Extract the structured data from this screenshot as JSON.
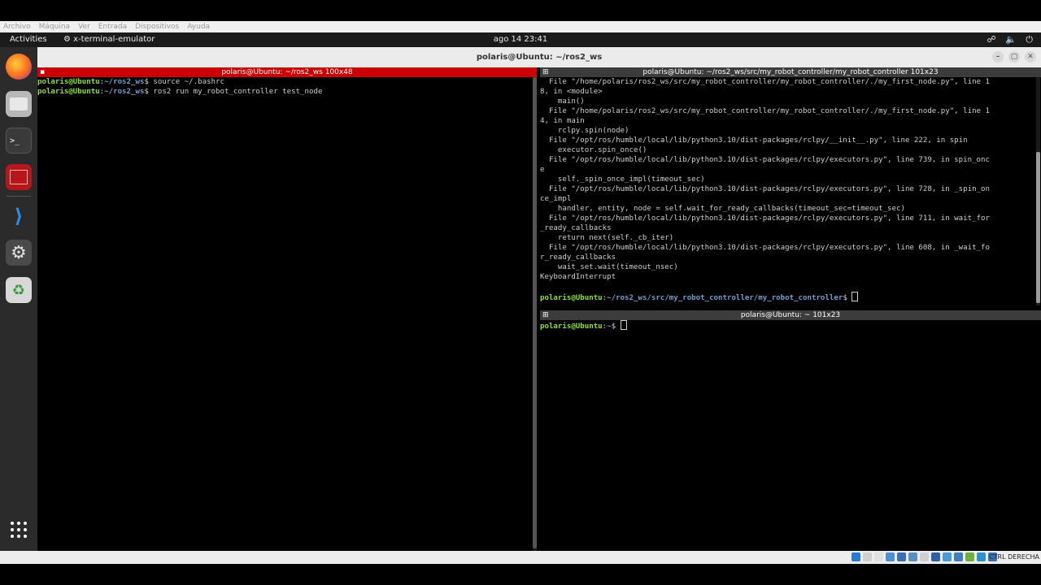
{
  "vbox_menu": [
    "Archivo",
    "Máquina",
    "Ver",
    "Entrada",
    "Dispositivos",
    "Ayuda"
  ],
  "topbar": {
    "activities": "Activities",
    "app_icon": "terminal-app-icon",
    "app_name": "x-terminal-emulator",
    "clock": "ago 14  23:41",
    "tray_icons": [
      "network-icon",
      "volume-icon",
      "power-icon"
    ]
  },
  "dock": {
    "items": [
      "firefox-icon",
      "files-icon",
      "terminal-icon",
      "terminator-icon",
      "vscode-icon",
      "settings-icon",
      "trash-icon"
    ],
    "show_apps": "show-apps-grid-icon"
  },
  "window": {
    "title": "polaris@Ubuntu: ~/ros2_ws",
    "buttons": [
      "minimize",
      "maximize",
      "close"
    ]
  },
  "colors": {
    "active_terminal_header": "#cc0000",
    "inactive_terminal_header": "#3c3c3c",
    "prompt_user": "#8ae234",
    "prompt_path": "#729fcf"
  },
  "term_left": {
    "title": "polaris@Ubuntu: ~/ros2_ws 100x48",
    "lines": [
      {
        "user": "polaris@Ubuntu",
        "path": "~/ros2_ws",
        "cmd": " source ~/.bashrc"
      },
      {
        "user": "polaris@Ubuntu",
        "path": "~/ros2_ws",
        "cmd": " ros2 run my_robot_controller test_node"
      }
    ]
  },
  "term_top_right": {
    "title": "polaris@Ubuntu: ~/ros2_ws/src/my_robot_controller/my_robot_controller 101x23",
    "output": [
      "  File \"/home/polaris/ros2_ws/src/my_robot_controller/my_robot_controller/./my_first_node.py\", line 1",
      "8, in <module>",
      "    main()",
      "  File \"/home/polaris/ros2_ws/src/my_robot_controller/my_robot_controller/./my_first_node.py\", line 1",
      "4, in main",
      "    rclpy.spin(node)",
      "  File \"/opt/ros/humble/local/lib/python3.10/dist-packages/rclpy/__init__.py\", line 222, in spin",
      "    executor.spin_once()",
      "  File \"/opt/ros/humble/local/lib/python3.10/dist-packages/rclpy/executors.py\", line 739, in spin_onc",
      "e",
      "    self._spin_once_impl(timeout_sec)",
      "  File \"/opt/ros/humble/local/lib/python3.10/dist-packages/rclpy/executors.py\", line 728, in _spin_on",
      "ce_impl",
      "    handler, entity, node = self.wait_for_ready_callbacks(timeout_sec=timeout_sec)",
      "  File \"/opt/ros/humble/local/lib/python3.10/dist-packages/rclpy/executors.py\", line 711, in wait_for",
      "_ready_callbacks",
      "    return next(self._cb_iter)",
      "  File \"/opt/ros/humble/local/lib/python3.10/dist-packages/rclpy/executors.py\", line 608, in _wait_fo",
      "r_ready_callbacks",
      "    wait_set.wait(timeout_nsec)",
      "KeyboardInterrupt",
      ""
    ],
    "prompt": {
      "user": "polaris@Ubuntu",
      "path": "~/ros2_ws/src/my_robot_controller/my_robot_controller"
    }
  },
  "term_bottom_right": {
    "title": "polaris@Ubuntu: ~ 101x23",
    "prompt": {
      "user": "polaris@Ubuntu",
      "path": "~"
    }
  },
  "statusbar": {
    "host_key": "CTRL DERECHA"
  }
}
